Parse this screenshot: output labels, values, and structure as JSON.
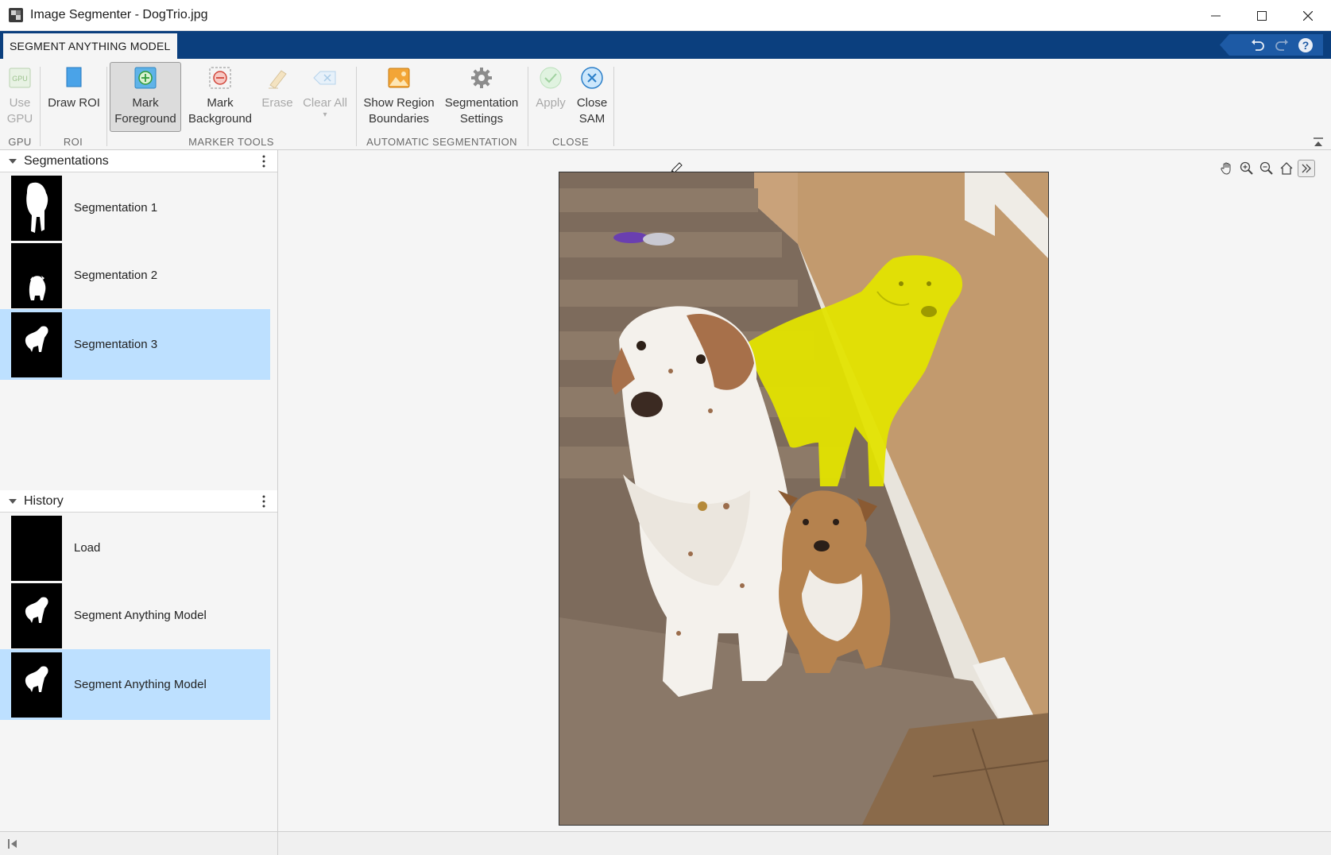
{
  "window": {
    "title": "Image Segmenter - DogTrio.jpg"
  },
  "tab": {
    "label": "SEGMENT ANYTHING MODEL"
  },
  "toolstrip": {
    "use_gpu": {
      "line1": "Use",
      "line2": "GPU",
      "icon": "gpu-icon",
      "enabled": false
    },
    "draw_roi": {
      "line1": "Draw ROI",
      "line2": "",
      "icon": "roi-icon"
    },
    "mark_foreground": {
      "line1": "Mark",
      "line2": "Foreground",
      "icon": "plus-circle-icon",
      "active": true
    },
    "mark_background": {
      "line1": "Mark",
      "line2": "Background",
      "icon": "minus-circle-icon"
    },
    "erase": {
      "line1": "Erase",
      "line2": "",
      "icon": "eraser-icon",
      "enabled": false
    },
    "clear_all": {
      "line1": "Clear All",
      "line2": "▾",
      "icon": "clear-all-icon",
      "enabled": false
    },
    "show_region_boundaries": {
      "line1": "Show Region",
      "line2": "Boundaries",
      "icon": "image-icon"
    },
    "segmentation_settings": {
      "line1": "Segmentation",
      "line2": "Settings",
      "icon": "gear-icon"
    },
    "apply": {
      "line1": "Apply",
      "line2": "",
      "icon": "check-icon",
      "enabled": false
    },
    "close_sam": {
      "line1": "Close",
      "line2": "SAM",
      "icon": "close-circle-icon"
    },
    "sections": {
      "gpu": "GPU",
      "roi": "ROI",
      "marker_tools": "MARKER TOOLS",
      "automatic_segmentation": "AUTOMATIC SEGMENTATION",
      "close": "CLOSE"
    }
  },
  "segmentations": {
    "title": "Segmentations",
    "items": [
      {
        "label": "Segmentation 1",
        "selected": false
      },
      {
        "label": "Segmentation 2",
        "selected": false
      },
      {
        "label": "Segmentation 3",
        "selected": true
      }
    ]
  },
  "history": {
    "title": "History",
    "items": [
      {
        "label": "Load",
        "selected": false
      },
      {
        "label": "Segment Anything Model",
        "selected": false
      },
      {
        "label": "Segment Anything Model",
        "selected": true
      }
    ]
  },
  "colors": {
    "tabstrip": "#0b3f7e",
    "selection": "#bde0ff",
    "mask_overlay": "#e3e300"
  }
}
